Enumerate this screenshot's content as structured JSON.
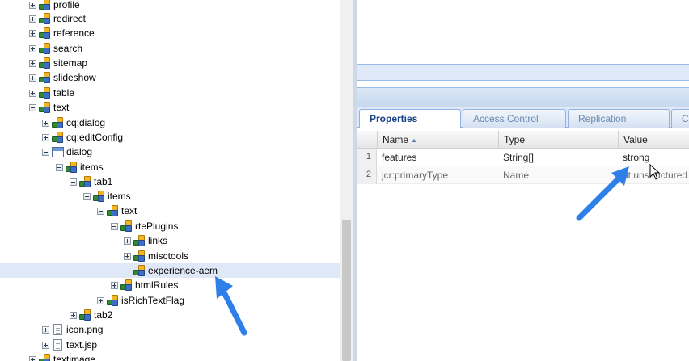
{
  "tree": {
    "nodes": [
      {
        "label": "profile",
        "icon": "node-icon",
        "expander": "plus"
      },
      {
        "label": "redirect",
        "icon": "node-icon",
        "expander": "plus"
      },
      {
        "label": "reference",
        "icon": "node-icon",
        "expander": "plus"
      },
      {
        "label": "search",
        "icon": "node-icon",
        "expander": "plus"
      },
      {
        "label": "sitemap",
        "icon": "node-icon",
        "expander": "plus"
      },
      {
        "label": "slideshow",
        "icon": "node-icon",
        "expander": "plus"
      },
      {
        "label": "table",
        "icon": "node-icon",
        "expander": "plus"
      },
      {
        "label": "text",
        "icon": "node-icon",
        "expander": "minus"
      },
      {
        "label": "cq:dialog",
        "icon": "node-icon",
        "expander": "plus"
      },
      {
        "label": "cq:editConfig",
        "icon": "node-icon",
        "expander": "plus"
      },
      {
        "label": "dialog",
        "icon": "dialog-icon",
        "expander": "minus"
      },
      {
        "label": "items",
        "icon": "node-icon",
        "expander": "minus"
      },
      {
        "label": "tab1",
        "icon": "node-icon",
        "expander": "minus"
      },
      {
        "label": "items",
        "icon": "node-icon",
        "expander": "minus"
      },
      {
        "label": "text",
        "icon": "node-icon",
        "expander": "minus"
      },
      {
        "label": "rtePlugins",
        "icon": "node-icon",
        "expander": "minus"
      },
      {
        "label": "links",
        "icon": "node-icon",
        "expander": "plus"
      },
      {
        "label": "misctools",
        "icon": "node-icon",
        "expander": "plus"
      },
      {
        "label": "experience-aem",
        "icon": "node-icon",
        "expander": "none",
        "selected": true
      },
      {
        "label": "htmlRules",
        "icon": "node-icon",
        "expander": "plus"
      },
      {
        "label": "isRichTextFlag",
        "icon": "node-icon",
        "expander": "plus"
      },
      {
        "label": "tab2",
        "icon": "node-icon",
        "expander": "plus"
      },
      {
        "label": "icon.png",
        "icon": "file-icon",
        "expander": "plus"
      },
      {
        "label": "text.jsp",
        "icon": "file-icon",
        "expander": "plus"
      },
      {
        "label": "textimage",
        "icon": "node-icon",
        "expander": "plus"
      }
    ]
  },
  "tabs": [
    {
      "label": "Properties",
      "active": true
    },
    {
      "label": "Access Control",
      "active": false
    },
    {
      "label": "Replication",
      "active": false
    },
    {
      "label": "Co",
      "active": false
    }
  ],
  "grid": {
    "columns": [
      "Name",
      "Type",
      "Value"
    ],
    "sort": "ascending",
    "rows": [
      {
        "num": "1",
        "name": "features",
        "type": "String[]",
        "value": "strong"
      },
      {
        "num": "2",
        "name": "jcr:primaryType",
        "type": "Name",
        "value": "nt:unstructured"
      }
    ]
  },
  "colors": {
    "selected_row": "#dfe8f6",
    "annotation_arrow": "#2f7fe8",
    "tab_active_text": "#15428b"
  }
}
